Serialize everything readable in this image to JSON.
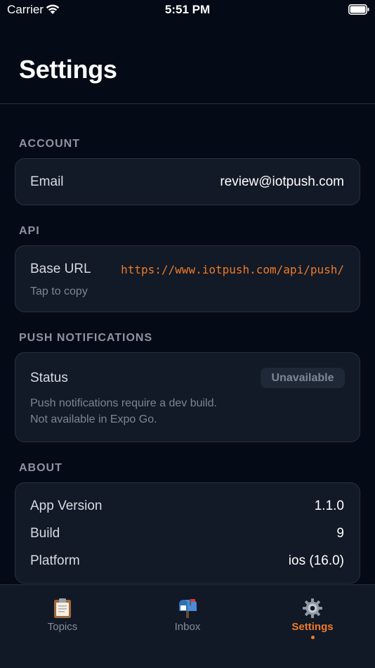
{
  "status_bar": {
    "carrier": "Carrier",
    "time": "5:51 PM"
  },
  "header": {
    "title": "Settings"
  },
  "account": {
    "section_label": "ACCOUNT",
    "email_label": "Email",
    "email_value": "review@iotpush.com"
  },
  "api": {
    "section_label": "API",
    "base_url_label": "Base URL",
    "base_url_value": "https://www.iotpush.com/api/push/",
    "hint": "Tap to copy"
  },
  "push": {
    "section_label": "PUSH NOTIFICATIONS",
    "status_label": "Status",
    "status_badge": "Unavailable",
    "hint_line1": "Push notifications require a dev build.",
    "hint_line2": "Not available in Expo Go."
  },
  "about": {
    "section_label": "ABOUT",
    "rows": [
      {
        "label": "App Version",
        "value": "1.1.0"
      },
      {
        "label": "Build",
        "value": "9"
      },
      {
        "label": "Platform",
        "value": "ios (16.0)"
      }
    ]
  },
  "tab_bar": {
    "tabs": [
      {
        "label": "Topics",
        "icon": "clipboard-icon"
      },
      {
        "label": "Inbox",
        "icon": "mailbox-icon"
      },
      {
        "label": "Settings",
        "icon": "gear-icon",
        "active": true
      }
    ]
  },
  "colors": {
    "background": "#050b16",
    "card": "#121a27",
    "accent": "#f07a26",
    "muted": "#8b94a3"
  }
}
